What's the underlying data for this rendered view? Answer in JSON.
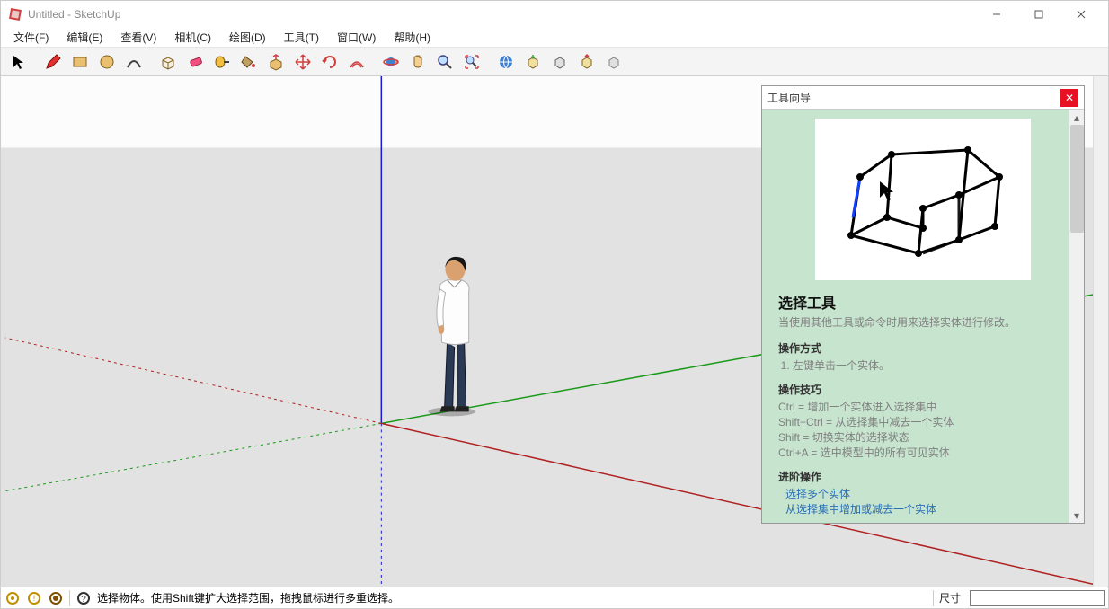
{
  "titlebar": {
    "title": "Untitled - SketchUp"
  },
  "menubar": {
    "items": [
      {
        "label": "文件(F)"
      },
      {
        "label": "编辑(E)"
      },
      {
        "label": "查看(V)"
      },
      {
        "label": "相机(C)"
      },
      {
        "label": "绘图(D)"
      },
      {
        "label": "工具(T)"
      },
      {
        "label": "窗口(W)"
      },
      {
        "label": "帮助(H)"
      }
    ]
  },
  "toolbar": {
    "groups": [
      [
        "select-tool"
      ],
      [
        "pencil-tool",
        "rectangle-tool",
        "circle-tool",
        "arc-tool"
      ],
      [
        "eraser-tool",
        "pushpull-tool",
        "tape-measure-tool",
        "paint-bucket-tool",
        "followme-tool",
        "offset-tool",
        "move-tool",
        "rotate-tool",
        "scale-tool"
      ],
      [
        "orbit-tool",
        "pan-tool",
        "zoom-tool",
        "zoom-extents-tool"
      ],
      [
        "warehouse-tool",
        "share-tool",
        "globe-tool",
        "extension-tool",
        "layers-tool"
      ]
    ],
    "icons": {
      "select-tool": "cursor",
      "pencil-tool": "pencil",
      "rectangle-tool": "rect",
      "circle-tool": "circle",
      "arc-tool": "arc",
      "eraser-tool": "eraser",
      "pushpull-tool": "box",
      "tape-measure-tool": "tape",
      "paint-bucket-tool": "bucket",
      "followme-tool": "follow",
      "offset-tool": "offset",
      "move-tool": "move",
      "rotate-tool": "rotate",
      "scale-tool": "scale",
      "orbit-tool": "orbit",
      "pan-tool": "pan",
      "zoom-tool": "zoom",
      "zoom-extents-tool": "zoomex",
      "warehouse-tool": "wh",
      "share-tool": "share",
      "globe-tool": "globe",
      "extension-tool": "ext",
      "layers-tool": "layers"
    }
  },
  "instructor": {
    "panel_title": "工具向导",
    "tool_title": "选择工具",
    "tool_desc": "当使用其他工具或命令时用来选择实体进行修改。",
    "op_heading": "操作方式",
    "op_step1": "左键单击一个实体。",
    "tips_heading": "操作技巧",
    "tip1": "Ctrl = 增加一个实体进入选择集中",
    "tip2": "Shift+Ctrl = 从选择集中减去一个实体",
    "tip3": "Shift = 切换实体的选择状态",
    "tip4": "Ctrl+A = 选中模型中的所有可见实体",
    "adv_heading": "进阶操作",
    "adv_link1": "选择多个实体",
    "adv_link2": "从选择集中增加或减去一个实体"
  },
  "statusbar": {
    "hint": "选择物体。使用Shift键扩大选择范围，拖拽鼠标进行多重选择。",
    "dim_label": "尺寸",
    "dim_value": ""
  },
  "colors": {
    "axis_red": "#b02020",
    "axis_green": "#1a9a1a",
    "axis_blue": "#1a1ad0",
    "panel_bg": "#c7e4ce",
    "close_red": "#e81123"
  }
}
